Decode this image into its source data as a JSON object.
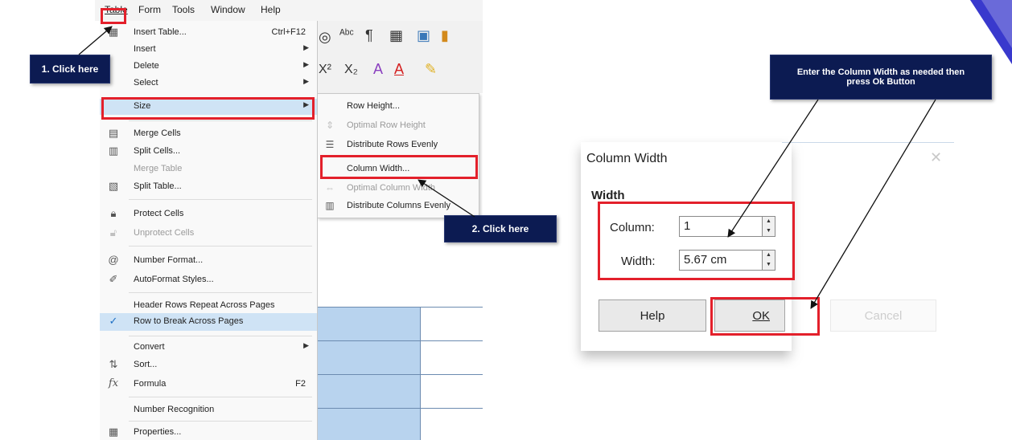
{
  "menubar": {
    "items": [
      "Table",
      "Form",
      "Tools",
      "Window",
      "Help"
    ]
  },
  "table_menu": {
    "items": [
      {
        "label": "Insert Table...",
        "shortcut": "Ctrl+F12",
        "icon": "table-icon"
      },
      {
        "label": "Insert",
        "submenu": true
      },
      {
        "label": "Delete",
        "submenu": true
      },
      {
        "label": "Select",
        "submenu": true
      },
      {
        "label": "Size",
        "submenu": true,
        "highlighted": true
      },
      {
        "label": "Merge Cells",
        "icon": "merge-cells-icon"
      },
      {
        "label": "Split Cells...",
        "icon": "split-cells-icon"
      },
      {
        "label": "Merge Table",
        "disabled": true
      },
      {
        "label": "Split Table...",
        "icon": "split-table-icon"
      },
      {
        "label": "Protect Cells",
        "icon": "lock-icon"
      },
      {
        "label": "Unprotect Cells",
        "icon": "unlock-icon",
        "disabled": true
      },
      {
        "label": "Number Format...",
        "icon": "number-format-icon"
      },
      {
        "label": "AutoFormat Styles...",
        "icon": "autoformat-icon"
      },
      {
        "label": "Header Rows Repeat Across Pages"
      },
      {
        "label": "Row to Break Across Pages",
        "checked": true
      },
      {
        "label": "Convert",
        "submenu": true
      },
      {
        "label": "Sort...",
        "icon": "sort-icon"
      },
      {
        "label": "Formula",
        "shortcut": "F2",
        "icon": "formula-icon"
      },
      {
        "label": "Number Recognition"
      },
      {
        "label": "Properties...",
        "icon": "properties-icon"
      }
    ]
  },
  "size_menu": {
    "items": [
      {
        "label": "Row Height..."
      },
      {
        "label": "Optimal Row Height",
        "disabled": true
      },
      {
        "label": "Distribute Rows Evenly"
      },
      {
        "label": "Column Width..."
      },
      {
        "label": "Optimal Column Width",
        "disabled": true
      },
      {
        "label": "Distribute Columns Evenly"
      }
    ]
  },
  "callouts": {
    "step1": "1. Click here",
    "step2": "2. Click here",
    "instruction": "Enter the Column Width as needed then press Ok Button"
  },
  "dialog": {
    "title": "Column Width",
    "section": "Width",
    "column_label": "Column:",
    "column_value": "1",
    "width_label": "Width:",
    "width_value": "5.67 cm",
    "help_button": "Help",
    "ok_button": "OK",
    "cancel_button": "Cancel",
    "close_glyph": "✕"
  },
  "colors": {
    "highlight_red": "#e3202b",
    "callout_navy": "#0c1b52",
    "table_cell_blue": "#b8d3ee"
  }
}
